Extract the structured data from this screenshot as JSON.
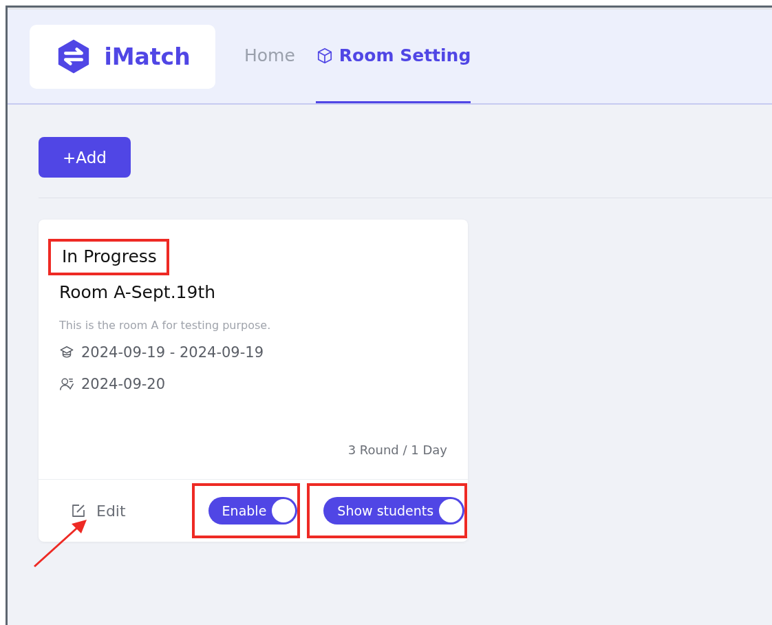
{
  "header": {
    "logo": {
      "name": "iMatch"
    },
    "nav": [
      {
        "label": "Home",
        "selected": false,
        "icon": false
      },
      {
        "label": "Room Setting",
        "selected": true,
        "icon": true
      }
    ]
  },
  "add_button": {
    "label": "+Add"
  },
  "rooms": [
    {
      "status": "In Progress",
      "status_highlighted": true,
      "title": "Room A-Sept.19th",
      "description": "This is the room A for testing purpose.",
      "dates": [
        {
          "kind": "period",
          "text": "2024-09-19 - 2024-09-19"
        },
        {
          "kind": "students",
          "text": "2024-09-20"
        }
      ],
      "rounds": "3 Round / 1 Day",
      "edit": {
        "label": "Edit",
        "arrow": true
      },
      "toggles": [
        {
          "label": "Enable",
          "on": true,
          "highlighted": true
        },
        {
          "label": "Show students",
          "on": true,
          "highlighted": true
        }
      ]
    }
  ]
}
